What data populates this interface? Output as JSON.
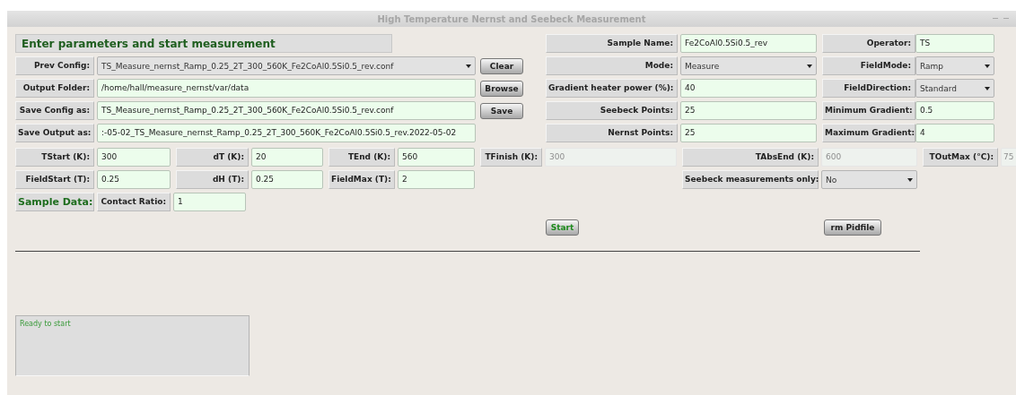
{
  "window": {
    "title": "High Temperature Nernst and Seebeck Measurement"
  },
  "heading": "Enter parameters and start measurement",
  "left_rows": [
    {
      "label": "Prev Config:",
      "kind": "dropdown",
      "value": "TS_Measure_nernst_Ramp_0.25_2T_300_560K_Fe2CoAl0.5Si0.5_rev.conf",
      "button": "Clear"
    },
    {
      "label": "Output Folder:",
      "kind": "field",
      "value": "/home/hall/measure_nernst/var/data",
      "button": "Browse"
    },
    {
      "label": "Save Config as:",
      "kind": "field",
      "value": "TS_Measure_nernst_Ramp_0.25_2T_300_560K_Fe2CoAl0.5Si0.5_rev.conf",
      "button": "Save"
    },
    {
      "label": "Save Output as:",
      "kind": "field",
      "value": ":-05-02_TS_Measure_nernst_Ramp_0.25_2T_300_560K_Fe2CoAl0.5Si0.5_rev.2022-05-02"
    }
  ],
  "right_rows": [
    {
      "label": "Sample Name:",
      "kind": "field",
      "value": "Fe2CoAl0.5Si0.5_rev"
    },
    {
      "label": "Operator:",
      "kind": "field",
      "value": "TS"
    },
    {
      "label": "Mode:",
      "kind": "dropdown",
      "value": "Measure"
    },
    {
      "label": "FieldMode:",
      "kind": "dropdown",
      "value": "Ramp"
    },
    {
      "label": "Gradient heater power (%):",
      "kind": "field",
      "value": "40"
    },
    {
      "label": "FieldDirection:",
      "kind": "dropdown",
      "value": "Standard"
    },
    {
      "label": "Seebeck Points:",
      "kind": "field",
      "value": "25"
    },
    {
      "label": "Minimum Gradient:",
      "kind": "field",
      "value": "0.5"
    },
    {
      "label": "Nernst Points:",
      "kind": "field",
      "value": "25"
    },
    {
      "label": "Maximum Gradient:",
      "kind": "field",
      "value": "4"
    }
  ],
  "temperature_row": [
    {
      "label": "TStart (K):",
      "value": "300",
      "disabled": false
    },
    {
      "label": "dT (K):",
      "value": "20",
      "disabled": false
    },
    {
      "label": "TEnd (K):",
      "value": "560",
      "disabled": false
    },
    {
      "label": "TFinish (K):",
      "value": "300",
      "disabled": true
    },
    {
      "label": "TAbsEnd (K):",
      "value": "600",
      "disabled": true
    },
    {
      "label": "TOutMax (°C):",
      "value": "75",
      "disabled": true
    }
  ],
  "field_row": [
    {
      "label": "FieldStart (T):",
      "value": "0.25"
    },
    {
      "label": "dH (T):",
      "value": "0.25"
    },
    {
      "label": "FieldMax (T):",
      "value": "2"
    }
  ],
  "seebeck_only": {
    "label": "Seebeck measurements only:",
    "value": "No"
  },
  "sample_data": {
    "heading": "Sample Data:",
    "label": "Contact Ratio:",
    "value": "1"
  },
  "start_button": "Start",
  "pidfile_button": "rm Pidfile",
  "status": "Ready to start"
}
